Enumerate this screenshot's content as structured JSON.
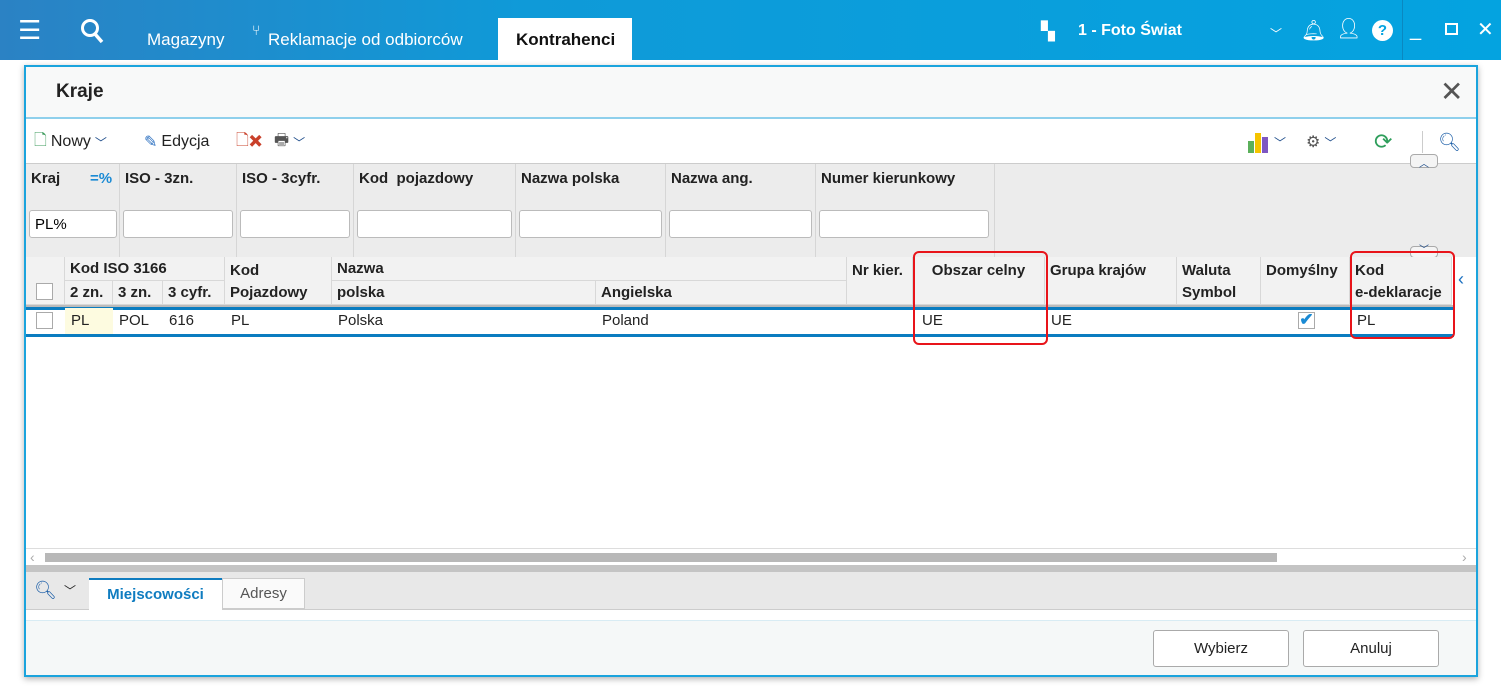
{
  "topbar": {
    "tabs": [
      {
        "label": "Magazyny"
      },
      {
        "label": "Reklamacje od odbiorców"
      },
      {
        "label": "Kontrahenci"
      }
    ],
    "company": "1 - Foto Świat"
  },
  "dialog": {
    "title": "Kraje",
    "toolbar": {
      "new_label": "Nowy",
      "edit_label": "Edycja"
    },
    "filters": [
      {
        "label": "Kraj",
        "value": "PL%",
        "op": "=%"
      },
      {
        "label": "ISO - 3zn.",
        "value": ""
      },
      {
        "label": "ISO - 3cyfr.",
        "value": ""
      },
      {
        "label": "Kod  pojazdowy",
        "value": ""
      },
      {
        "label": "Nazwa polska",
        "value": ""
      },
      {
        "label": "Nazwa ang.",
        "value": ""
      },
      {
        "label": "Numer kierunkowy",
        "value": ""
      }
    ],
    "grid": {
      "group_headers": {
        "iso": "Kod ISO 3166",
        "kod": "Kod",
        "nazwa": "Nazwa"
      },
      "headers": {
        "zn2": "2 zn.",
        "zn3": "3 zn.",
        "cyfr3": "3 cyfr.",
        "pojazdowy": "Pojazdowy",
        "polska": "polska",
        "angielska": "Angielska",
        "nr_kier": "Nr kier.",
        "obszar": "Obszar celny",
        "grupa": "Grupa krajów",
        "waluta1": "Waluta",
        "waluta2": "Symbol",
        "domyslny": "Domyślny",
        "edek1": "Kod",
        "edek2": "e-deklaracje"
      },
      "rows": [
        {
          "zn2": "PL",
          "zn3": "POL",
          "cyfr3": "616",
          "pojazdowy": "PL",
          "polska": "Polska",
          "angielska": "Poland",
          "nr_kier": "",
          "obszar": "UE",
          "grupa": "UE",
          "waluta": "",
          "domyslny": true,
          "edek": "PL"
        }
      ]
    },
    "bottom_tabs": [
      {
        "label": "Miejscowości"
      },
      {
        "label": "Adresy"
      }
    ],
    "buttons": {
      "select": "Wybierz",
      "cancel": "Anuluj"
    }
  },
  "colors": {
    "accent": "#04a3e0",
    "highlight": "#e8141a",
    "active_tab": "#0f7cc0"
  }
}
